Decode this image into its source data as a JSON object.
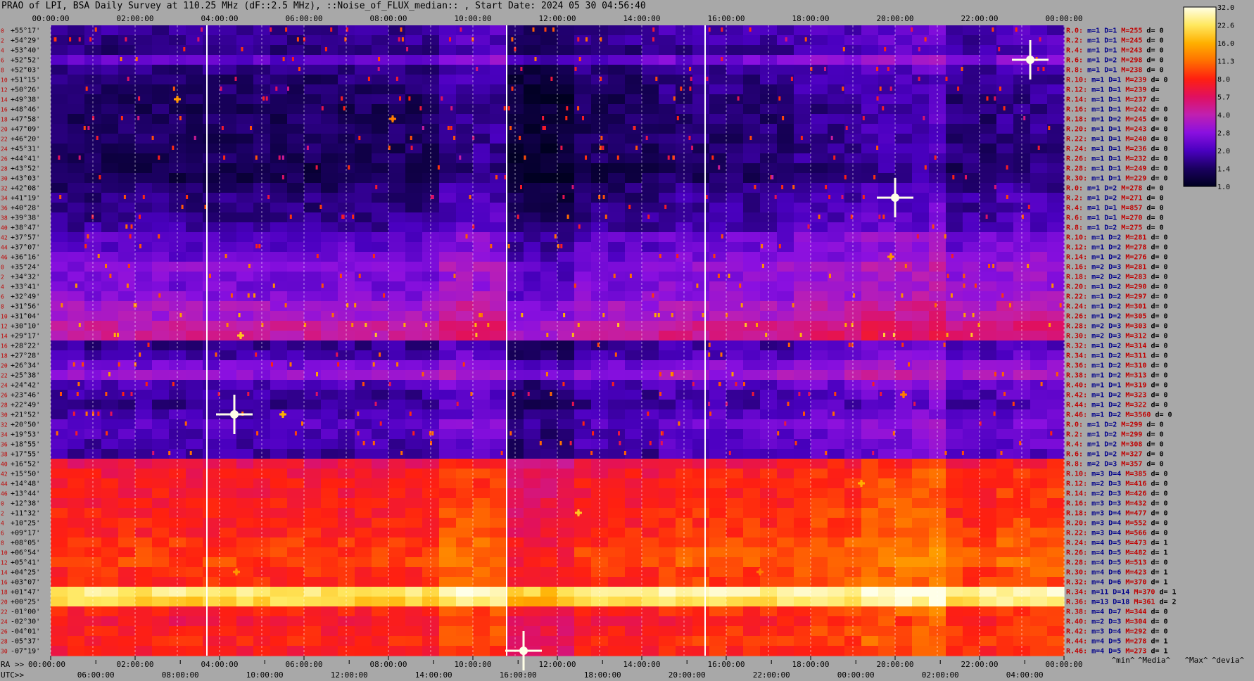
{
  "title": "PRAO of LPI, BSA Daily Survey at 110.25 MHz (dF::2.5 MHz), ::Noise_of_FLUX_median:: , Start Date: 2024 05 30 04:56:40",
  "chart_data": {
    "type": "heatmap",
    "title": "PRAO of LPI, BSA Daily Survey at 110.25 MHz (dF::2.5 MHz), ::Noise_of_FLUX_median:: , Start Date: 2024 05 30 04:56:40",
    "x_top_ticks": [
      "00:00:00",
      "02:00:00",
      "04:00:00",
      "06:00:00",
      "08:00:00",
      "10:00:00",
      "12:00:00",
      "14:00:00",
      "16:00:00",
      "18:00:00",
      "20:00:00",
      "22:00:00",
      "00:00:00"
    ],
    "ra_label": "RA >>",
    "ra_ticks": [
      "00:00:00",
      "02:00:00",
      "04:00:00",
      "06:00:00",
      "08:00:00",
      "10:00:00",
      "12:00:00",
      "14:00:00",
      "16:00:00",
      "18:00:00",
      "20:00:00",
      "22:00:00",
      "00:00:00"
    ],
    "utc_label": "UTC>>",
    "utc_ticks": [
      "06:00:00",
      "08:00:00",
      "10:00:00",
      "12:00:00",
      "14:00:00",
      "16:00:00",
      "18:00:00",
      "20:00:00",
      "22:00:00",
      "00:00:00",
      "02:00:00",
      "04:00:00"
    ],
    "row_index": [
      0,
      2,
      4,
      6,
      8,
      10,
      12,
      14,
      16,
      18,
      20,
      22,
      24,
      26,
      28,
      30,
      32,
      34,
      36,
      38,
      40,
      42,
      44,
      46,
      0,
      2,
      4,
      6,
      8,
      10,
      12,
      14,
      16,
      18,
      20,
      22,
      24,
      26,
      28,
      30,
      32,
      34,
      36,
      38,
      40,
      42,
      44,
      46,
      0,
      2,
      4,
      6,
      8,
      10,
      12,
      14,
      16,
      18,
      20,
      22,
      24,
      26,
      28,
      30,
      32,
      34,
      36,
      38,
      40,
      42,
      44,
      46
    ],
    "declinations": [
      "+55°17'",
      "+54°29'",
      "+53°40'",
      "+52°52'",
      "+52°03'",
      "+51°15'",
      "+50°26'",
      "+49°38'",
      "+48°46'",
      "+47°58'",
      "+47°09'",
      "+46°20'",
      "+45°31'",
      "+44°41'",
      "+43°52'",
      "+43°03'",
      "+42°08'",
      "+41°19'",
      "+40°28'",
      "+39°38'",
      "+38°47'",
      "+37°57'",
      "+37°07'",
      "+36°16'",
      "+35°24'",
      "+34°32'",
      "+33°41'",
      "+32°49'",
      "+31°56'",
      "+31°04'",
      "+30°10'",
      "+29°17'",
      "+28°22'",
      "+27°28'",
      "+26°34'",
      "+25°38'",
      "+24°42'",
      "+23°46'",
      "+22°49'",
      "+21°52'",
      "+20°50'",
      "+19°53'",
      "+18°55'",
      "+17°55'",
      "+16°52'",
      "+15°50'",
      "+14°48'",
      "+13°44'",
      "+12°38'",
      "+11°32'",
      "+10°25'",
      "+09°17'",
      "+08°05'",
      "+06°54'",
      "+05°41'",
      "+04°25'",
      "+03°07'",
      "+01°47'",
      "+00°25'",
      "-01°00'",
      "-02°30'",
      "-04°01'",
      "-05°37'",
      "-07°19'"
    ],
    "row_stats": [
      {
        "r": "R.0:",
        "m": "m=1",
        "D": "D=1",
        "M": "M=255",
        "d": "d= 0"
      },
      {
        "r": "R.2:",
        "m": "m=1",
        "D": "D=1",
        "M": "M=245",
        "d": "d= 0"
      },
      {
        "r": "R.4:",
        "m": "m=1",
        "D": "D=1",
        "M": "M=243",
        "d": "d= 0"
      },
      {
        "r": "R.6:",
        "m": "m=1",
        "D": "D=2",
        "M": "M=298",
        "d": "d= 0"
      },
      {
        "r": "R.8:",
        "m": "m=1",
        "D": "D=1",
        "M": "M=238",
        "d": "d= 0"
      },
      {
        "r": "R.10:",
        "m": "m=1",
        "D": "D=1",
        "M": "M=239",
        "d": "d= 0"
      },
      {
        "r": "R.12:",
        "m": "m=1",
        "D": "D=1",
        "M": "M=239",
        "d": "d="
      },
      {
        "r": "R.14:",
        "m": "m=1",
        "D": "D=1",
        "M": "M=237",
        "d": "d="
      },
      {
        "r": "R.16:",
        "m": "m=1",
        "D": "D=1",
        "M": "M=242",
        "d": "d= 0"
      },
      {
        "r": "R.18:",
        "m": "m=1",
        "D": "D=2",
        "M": "M=245",
        "d": "d= 0"
      },
      {
        "r": "R.20:",
        "m": "m=1",
        "D": "D=1",
        "M": "M=243",
        "d": "d= 0"
      },
      {
        "r": "R.22:",
        "m": "m=1",
        "D": "D=1",
        "M": "M=240",
        "d": "d= 0"
      },
      {
        "r": "R.24:",
        "m": "m=1",
        "D": "D=1",
        "M": "M=236",
        "d": "d= 0"
      },
      {
        "r": "R.26:",
        "m": "m=1",
        "D": "D=1",
        "M": "M=232",
        "d": "d= 0"
      },
      {
        "r": "R.28:",
        "m": "m=1",
        "D": "D=1",
        "M": "M=249",
        "d": "d= 0"
      },
      {
        "r": "R.30:",
        "m": "m=1",
        "D": "D=1",
        "M": "M=229",
        "d": "d= 0"
      },
      {
        "r": "R.0:",
        "m": "m=1",
        "D": "D=2",
        "M": "M=278",
        "d": "d= 0"
      },
      {
        "r": "R.2:",
        "m": "m=1",
        "D": "D=2",
        "M": "M=271",
        "d": "d= 0"
      },
      {
        "r": "R.4:",
        "m": "m=1",
        "D": "D=1",
        "M": "M=857",
        "d": "d= 0"
      },
      {
        "r": "R.6:",
        "m": "m=1",
        "D": "D=1",
        "M": "M=270",
        "d": "d= 0"
      },
      {
        "r": "R.8:",
        "m": "m=1",
        "D": "D=2",
        "M": "M=275",
        "d": "d= 0"
      },
      {
        "r": "R.10:",
        "m": "m=1",
        "D": "D=2",
        "M": "M=281",
        "d": "d= 0"
      },
      {
        "r": "R.12:",
        "m": "m=1",
        "D": "D=2",
        "M": "M=278",
        "d": "d= 0"
      },
      {
        "r": "R.14:",
        "m": "m=1",
        "D": "D=2",
        "M": "M=276",
        "d": "d= 0"
      },
      {
        "r": "R.16:",
        "m": "m=2",
        "D": "D=3",
        "M": "M=281",
        "d": "d= 0"
      },
      {
        "r": "R.18:",
        "m": "m=2",
        "D": "D=2",
        "M": "M=283",
        "d": "d= 0"
      },
      {
        "r": "R.20:",
        "m": "m=1",
        "D": "D=2",
        "M": "M=290",
        "d": "d= 0"
      },
      {
        "r": "R.22:",
        "m": "m=1",
        "D": "D=2",
        "M": "M=297",
        "d": "d= 0"
      },
      {
        "r": "R.24:",
        "m": "m=1",
        "D": "D=2",
        "M": "M=301",
        "d": "d= 0"
      },
      {
        "r": "R.26:",
        "m": "m=1",
        "D": "D=2",
        "M": "M=305",
        "d": "d= 0"
      },
      {
        "r": "R.28:",
        "m": "m=2",
        "D": "D=3",
        "M": "M=303",
        "d": "d= 0"
      },
      {
        "r": "R.30:",
        "m": "m=2",
        "D": "D=3",
        "M": "M=312",
        "d": "d= 0"
      },
      {
        "r": "R.32:",
        "m": "m=1",
        "D": "D=2",
        "M": "M=314",
        "d": "d= 0"
      },
      {
        "r": "R.34:",
        "m": "m=1",
        "D": "D=2",
        "M": "M=311",
        "d": "d= 0"
      },
      {
        "r": "R.36:",
        "m": "m=1",
        "D": "D=2",
        "M": "M=310",
        "d": "d= 0"
      },
      {
        "r": "R.38:",
        "m": "m=1",
        "D": "D=2",
        "M": "M=313",
        "d": "d= 0"
      },
      {
        "r": "R.40:",
        "m": "m=1",
        "D": "D=1",
        "M": "M=319",
        "d": "d= 0"
      },
      {
        "r": "R.42:",
        "m": "m=1",
        "D": "D=2",
        "M": "M=323",
        "d": "d= 0"
      },
      {
        "r": "R.44:",
        "m": "m=1",
        "D": "D=2",
        "M": "M=322",
        "d": "d= 0"
      },
      {
        "r": "R.46:",
        "m": "m=1",
        "D": "D=2",
        "M": "M=3560",
        "d": "d= 0"
      },
      {
        "r": "R.0:",
        "m": "m=1",
        "D": "D=2",
        "M": "M=299",
        "d": "d= 0"
      },
      {
        "r": "R.2:",
        "m": "m=1",
        "D": "D=2",
        "M": "M=299",
        "d": "d= 0"
      },
      {
        "r": "R.4:",
        "m": "m=1",
        "D": "D=2",
        "M": "M=308",
        "d": "d= 0"
      },
      {
        "r": "R.6:",
        "m": "m=1",
        "D": "D=2",
        "M": "M=327",
        "d": "d= 0"
      },
      {
        "r": "R.8:",
        "m": "m=2",
        "D": "D=3",
        "M": "M=357",
        "d": "d= 0"
      },
      {
        "r": "R.10:",
        "m": "m=3",
        "D": "D=4",
        "M": "M=385",
        "d": "d= 0"
      },
      {
        "r": "R.12:",
        "m": "m=2",
        "D": "D=3",
        "M": "M=416",
        "d": "d= 0"
      },
      {
        "r": "R.14:",
        "m": "m=2",
        "D": "D=3",
        "M": "M=426",
        "d": "d= 0"
      },
      {
        "r": "R.16:",
        "m": "m=3",
        "D": "D=3",
        "M": "M=432",
        "d": "d= 0"
      },
      {
        "r": "R.18:",
        "m": "m=3",
        "D": "D=4",
        "M": "M=477",
        "d": "d= 0"
      },
      {
        "r": "R.20:",
        "m": "m=3",
        "D": "D=4",
        "M": "M=552",
        "d": "d= 0"
      },
      {
        "r": "R.22:",
        "m": "m=3",
        "D": "D=4",
        "M": "M=566",
        "d": "d= 0"
      },
      {
        "r": "R.24:",
        "m": "m=4",
        "D": "D=5",
        "M": "M=473",
        "d": "d= 1"
      },
      {
        "r": "R.26:",
        "m": "m=4",
        "D": "D=5",
        "M": "M=482",
        "d": "d= 1"
      },
      {
        "r": "R.28:",
        "m": "m=4",
        "D": "D=5",
        "M": "M=513",
        "d": "d= 0"
      },
      {
        "r": "R.30:",
        "m": "m=4",
        "D": "D=6",
        "M": "M=423",
        "d": "d= 1"
      },
      {
        "r": "R.32:",
        "m": "m=4",
        "D": "D=6",
        "M": "M=370",
        "d": "d= 1"
      },
      {
        "r": "R.34:",
        "m": "m=11",
        "D": "D=14",
        "M": "M=370",
        "d": "d= 1"
      },
      {
        "r": "R.36:",
        "m": "m=13",
        "D": "D=18",
        "M": "M=361",
        "d": "d= 2"
      },
      {
        "r": "R.38:",
        "m": "m=4",
        "D": "D=7",
        "M": "M=344",
        "d": "d= 0"
      },
      {
        "r": "R.40:",
        "m": "m=2",
        "D": "D=3",
        "M": "M=304",
        "d": "d= 0"
      },
      {
        "r": "R.42:",
        "m": "m=3",
        "D": "D=4",
        "M": "M=292",
        "d": "d= 0"
      },
      {
        "r": "R.44:",
        "m": "m=4",
        "D": "D=5",
        "M": "M=278",
        "d": "d= 1"
      },
      {
        "r": "R.46:",
        "m": "m=4",
        "D": "D=5",
        "M": "M=273",
        "d": "d= 1"
      }
    ],
    "row_levels": [
      1.7,
      1.7,
      1.6,
      2.3,
      1.6,
      1.5,
      1.5,
      1.4,
      1.4,
      1.4,
      1.4,
      1.4,
      1.4,
      1.4,
      1.3,
      1.3,
      1.5,
      1.6,
      1.6,
      1.7,
      1.8,
      2.2,
      2.2,
      2.4,
      2.8,
      2.6,
      2.6,
      2.8,
      3.3,
      3.4,
      4.2,
      4.4,
      1.7,
      1.9,
      2.5,
      3.0,
      2.0,
      1.8,
      1.7,
      1.9,
      2.1,
      2.0,
      1.9,
      1.8,
      6.2,
      7.0,
      7.2,
      7.3,
      7.4,
      7.6,
      7.8,
      7.9,
      8.6,
      9.0,
      9.2,
      8.4,
      8.2,
      24,
      20,
      7.8,
      6.8,
      7.6,
      7.9,
      7.4
    ],
    "sources": [
      {
        "ra": 4.35,
        "row": 39,
        "level": 32
      },
      {
        "ra": 4.5,
        "row": 31,
        "level": 18
      },
      {
        "ra": 5.5,
        "row": 39,
        "level": 16
      },
      {
        "ra": 20.0,
        "row": 17,
        "level": 32
      },
      {
        "ra": 19.9,
        "row": 23,
        "level": 14
      },
      {
        "ra": 19.2,
        "row": 46,
        "level": 16
      },
      {
        "ra": 12.5,
        "row": 49,
        "level": 18
      },
      {
        "ra": 11.2,
        "row": 63,
        "level": 32
      },
      {
        "ra": 23.2,
        "row": 3,
        "level": 32
      },
      {
        "ra": 4.4,
        "row": 55,
        "level": 14
      },
      {
        "ra": 16.8,
        "row": 55,
        "level": 12
      },
      {
        "ra": 3.0,
        "row": 7,
        "level": 14
      },
      {
        "ra": 8.1,
        "row": 9,
        "level": 12
      },
      {
        "ra": 20.2,
        "row": 37,
        "level": 12
      }
    ],
    "row_stat_legend": {
      "min": "^min^",
      "media": "^Media^",
      "max": "^Max^",
      "devia": "^devia^"
    },
    "colorbar": {
      "ticks": [
        "32.0",
        "22.6",
        "16.0",
        "11.3",
        "8.0",
        "5.7",
        "4.0",
        "2.8",
        "2.0",
        "1.4",
        "1.0"
      ],
      "range": [
        1.0,
        32.0
      ],
      "scale": "log"
    },
    "colors": {
      "background": "#a8a8a8",
      "stat_label": "#c00000",
      "stat_value": "#00008b"
    }
  }
}
